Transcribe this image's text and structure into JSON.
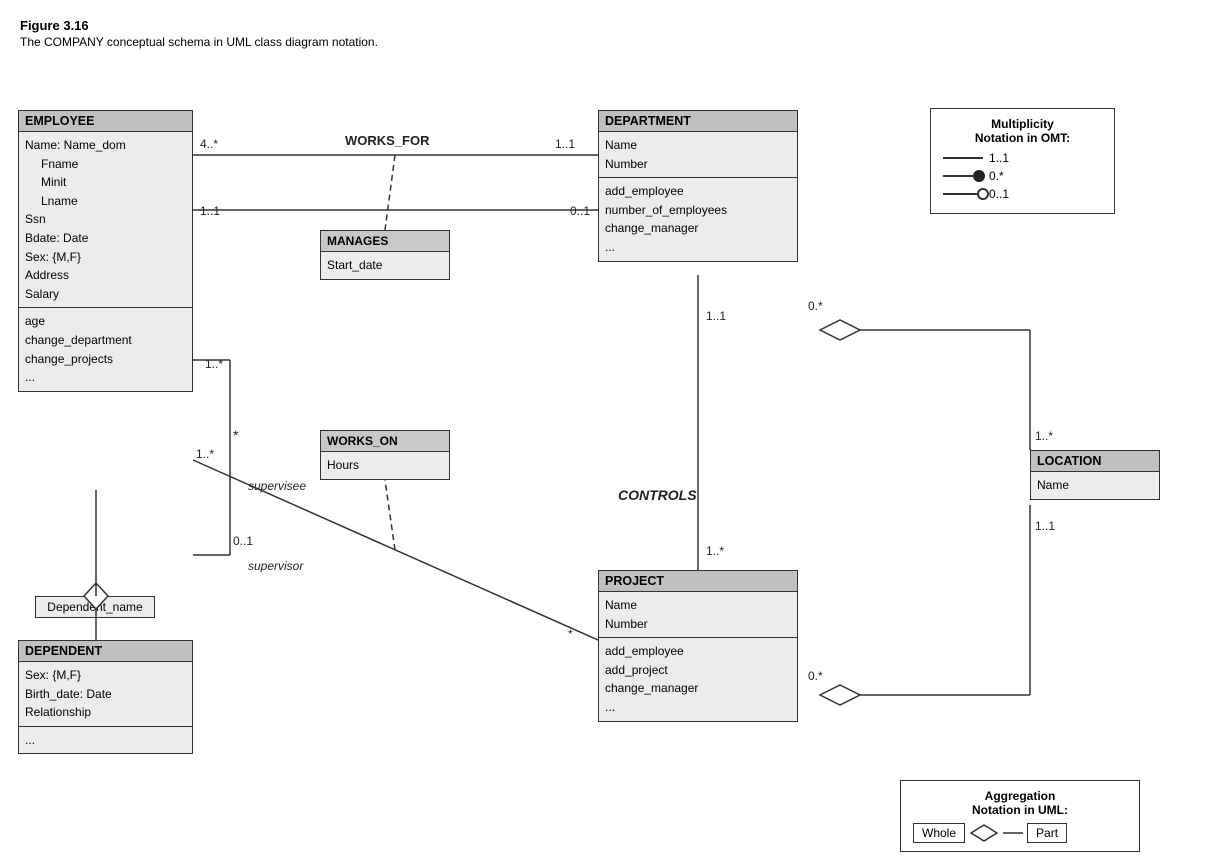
{
  "figure": {
    "title": "Figure 3.16",
    "caption": "The COMPANY conceptual schema in UML class diagram notation."
  },
  "classes": {
    "employee": {
      "header": "EMPLOYEE",
      "section1": [
        "Name: Name_dom",
        "    Fname",
        "    Minit",
        "    Lname",
        "Ssn",
        "Bdate: Date",
        "Sex: {M,F}",
        "Address",
        "Salary"
      ],
      "section2": [
        "age",
        "change_department",
        "change_projects",
        "..."
      ]
    },
    "department": {
      "header": "DEPARTMENT",
      "section1": [
        "Name",
        "Number"
      ],
      "section2": [
        "add_employee",
        "number_of_employees",
        "change_manager",
        "..."
      ]
    },
    "project": {
      "header": "PROJECT",
      "section1": [
        "Name",
        "Number"
      ],
      "section2": [
        "add_employee",
        "add_project",
        "change_manager",
        "..."
      ]
    },
    "dependent": {
      "header": "DEPENDENT",
      "section1": [
        "Sex: {M,F}",
        "Birth_date: Date",
        "Relationship"
      ],
      "section2": [
        "..."
      ]
    },
    "location": {
      "header": "LOCATION",
      "section1": [
        "Name"
      ]
    }
  },
  "assocClasses": {
    "manages": {
      "header": "MANAGES",
      "section": [
        "Start_date"
      ]
    },
    "worksOn": {
      "header": "WORKS_ON",
      "section": [
        "Hours"
      ]
    }
  },
  "labels": {
    "works_for": "WORKS_FOR",
    "controls": "CONTROLS",
    "supervisee": "supervisee",
    "supervisor": "supervisor",
    "dependent_name": "Dependent_name",
    "mults": {
      "emp_dept_emp": "4..*",
      "emp_dept_dept": "1..1",
      "emp_manages_emp": "1..1",
      "dept_manages_dept": "0..1",
      "emp_sup_many": "1..*",
      "emp_sup_star": "*",
      "emp_sup_01": "0..1",
      "dept_controls_11": "1..1",
      "dept_controls_star": "0.*",
      "dept_loc_star": "1..*",
      "loc_loc_11": "1..1",
      "proj_dept_star": "1..*",
      "proj_works_star": "*",
      "proj_agg_star": "0.*"
    }
  },
  "notationBox": {
    "title": "Multiplicity\nNotation in OMT:",
    "rows": [
      {
        "line": true,
        "symbol": "none",
        "label": "1..1"
      },
      {
        "line": true,
        "symbol": "dot",
        "label": "0.*"
      },
      {
        "line": true,
        "symbol": "circle",
        "label": "0..1"
      }
    ]
  },
  "aggregationBox": {
    "title1": "Aggregation",
    "title2": "Notation in UML:",
    "whole": "Whole",
    "part": "Part"
  }
}
